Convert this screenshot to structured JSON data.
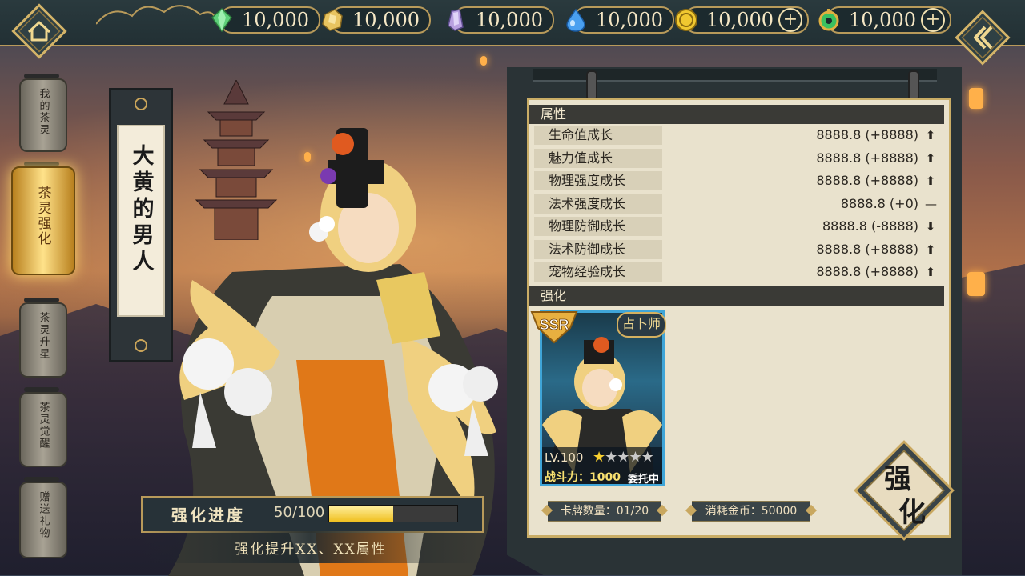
{
  "resources": [
    {
      "icon": "green-gem-icon",
      "value": "10,000",
      "plus": false
    },
    {
      "icon": "gold-ore-icon",
      "value": "10,000",
      "plus": false
    },
    {
      "icon": "purple-crystal-icon",
      "value": "10,000",
      "plus": false
    },
    {
      "icon": "water-drop-icon",
      "value": "10,000",
      "plus": false
    },
    {
      "icon": "gold-coin-icon",
      "value": "10,000",
      "plus": true
    },
    {
      "icon": "jade-pendant-icon",
      "value": "10,000",
      "plus": true
    }
  ],
  "nav": [
    {
      "label": "我的茶灵",
      "active": false
    },
    {
      "label": "茶灵强化",
      "active": true
    },
    {
      "label": "茶灵升星",
      "active": false
    },
    {
      "label": "茶灵觉醒",
      "active": false
    },
    {
      "label": "赠送礼物",
      "active": false
    }
  ],
  "character": {
    "name": "大黄的男人"
  },
  "progress": {
    "label": "强化进度",
    "value_text": "50/100",
    "fraction": 0.5,
    "description": "强化提升XX、XX属性"
  },
  "attributes": {
    "title": "属性",
    "rows": [
      {
        "name": "生命值成长",
        "value": "8888.8 (+8888)",
        "trend": "up"
      },
      {
        "name": "魅力值成长",
        "value": "8888.8 (+8888)",
        "trend": "up"
      },
      {
        "name": "物理强度成长",
        "value": "8888.8 (+8888)",
        "trend": "up"
      },
      {
        "name": "法术强度成长",
        "value": "8888.8 (+0)",
        "trend": "none"
      },
      {
        "name": "物理防御成长",
        "value": "8888.8 (-8888)",
        "trend": "down"
      },
      {
        "name": "法术防御成长",
        "value": "8888.8 (+8888)",
        "trend": "up"
      },
      {
        "name": "宠物经验成长",
        "value": "8888.8 (+8888)",
        "trend": "up"
      }
    ]
  },
  "enhance": {
    "title": "强化",
    "card": {
      "rarity": "SSR",
      "role": "占卜师",
      "level": "LV.100",
      "stars_filled": 1,
      "stars_total": 5,
      "power": "战斗力：1000",
      "status": "委托中"
    },
    "card_count": "卡牌数量：01/20",
    "cost": "消耗金币：50000",
    "button_label": "强化"
  },
  "colors": {
    "gold": "#c9ad66",
    "panel_bg": "#e9e2cd",
    "card_border": "#3fa5d8"
  }
}
